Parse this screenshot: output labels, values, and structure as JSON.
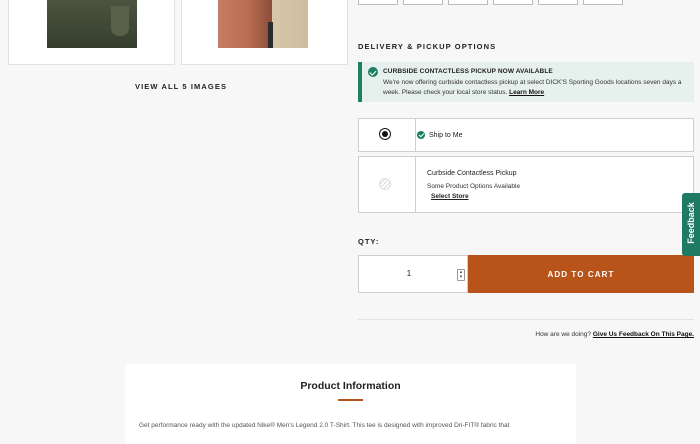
{
  "gallery": {
    "view_all_label": "VIEW ALL 5 IMAGES"
  },
  "delivery": {
    "heading": "DELIVERY & PICKUP OPTIONS",
    "notice": {
      "title": "CURBSIDE CONTACTLESS PICKUP NOW AVAILABLE",
      "body": "We're now offering curbside contactless pickup at select DICK'S Sporting Goods locations seven days a week. Please check your local store status.",
      "link": "Learn More"
    },
    "options": {
      "ship": {
        "label": "Ship to Me",
        "selected": true
      },
      "pickup": {
        "title": "Curbside Contactless Pickup",
        "subtitle": "Some Product Options Available",
        "link": "Select Store",
        "selected": false
      }
    }
  },
  "quantity": {
    "label": "QTY:",
    "value": "1"
  },
  "cart": {
    "button_label": "ADD TO CART",
    "button_color": "#b85419"
  },
  "feedback": {
    "question": "How are we doing?",
    "link": "Give Us Feedback On This Page.",
    "tab_label": "Feedback",
    "tab_color": "#1f7a63"
  },
  "product_info": {
    "title": "Product Information",
    "body": "Get performance ready with the updated Nike® Men's Legend 2.0 T-Shirt. This tee is designed with improved Dri-FIT® fabric that"
  }
}
